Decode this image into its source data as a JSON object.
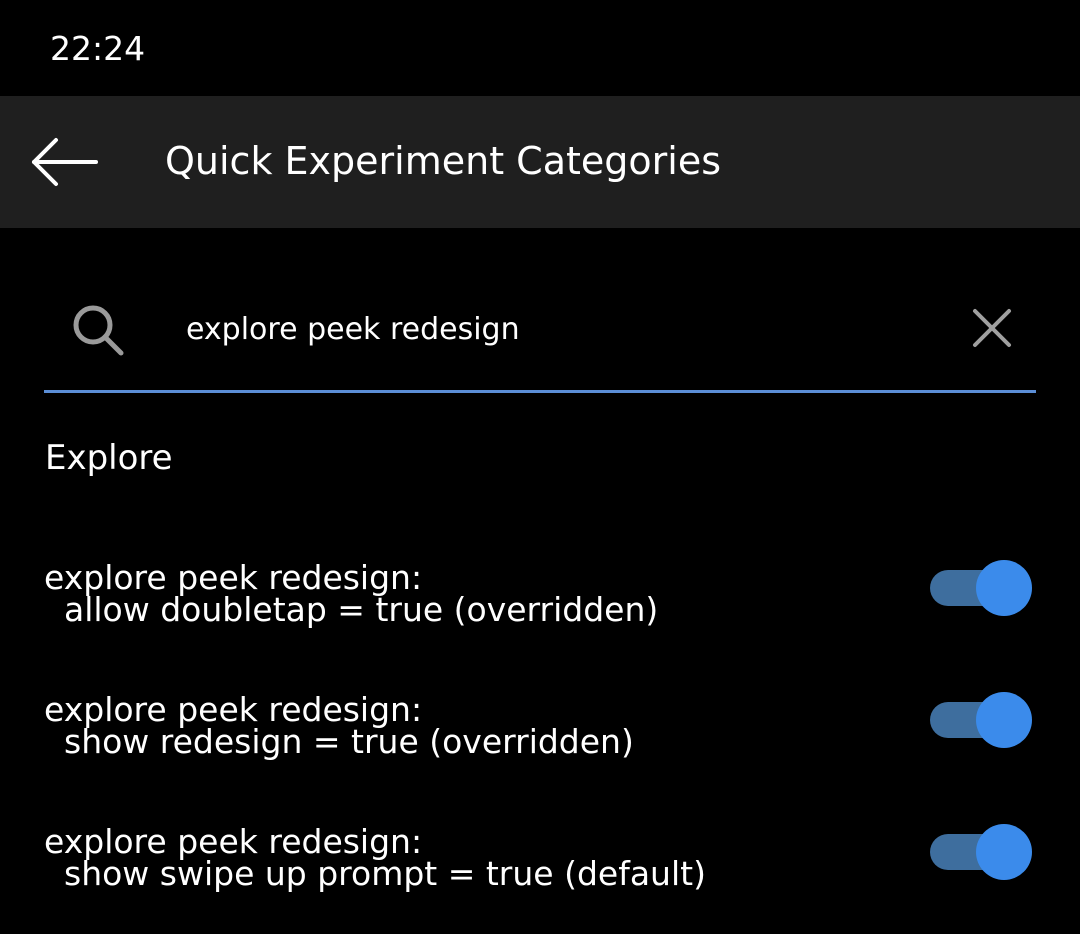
{
  "status_bar": {
    "time": "22:24"
  },
  "app_bar": {
    "back_icon": "arrow-left-icon",
    "title": "Quick Experiment Categories"
  },
  "search": {
    "icon": "search-icon",
    "value": "explore peek redesign",
    "clear_icon": "close-icon",
    "underline_color": "#5b8ed6"
  },
  "category": {
    "heading": "Explore"
  },
  "settings": [
    {
      "line1": "explore peek redesign:",
      "line2": "allow doubletap = true (overridden)",
      "enabled": true
    },
    {
      "line1": "explore peek redesign:",
      "line2": "show redesign = true (overridden)",
      "enabled": true
    },
    {
      "line1": "explore peek redesign:",
      "line2": "show swipe up prompt = true (default)",
      "enabled": true
    }
  ],
  "colors": {
    "background": "#000000",
    "app_bar": "#1f1f1f",
    "toggle_thumb": "#3b8beb",
    "toggle_track": "#3e6e9e"
  }
}
